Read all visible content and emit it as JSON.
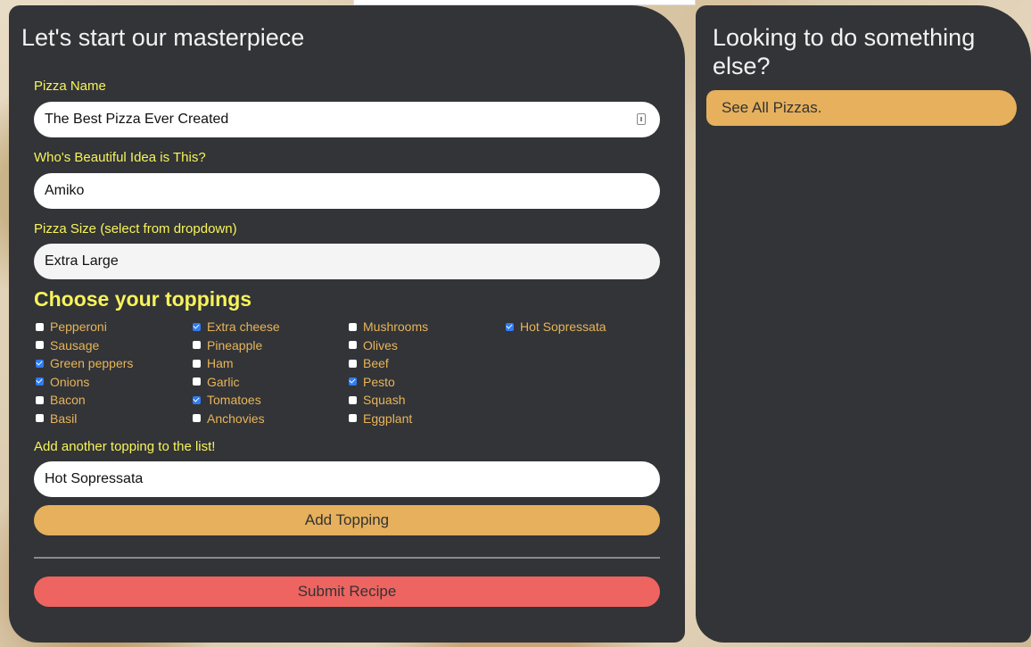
{
  "main": {
    "title": "Let's start our masterpiece",
    "pizza_name": {
      "label": "Pizza Name",
      "value": "The Best Pizza Ever Created"
    },
    "creator": {
      "label": "Who's Beautiful Idea is This?",
      "value": "Amiko"
    },
    "size": {
      "label": "Pizza Size (select from dropdown)",
      "value": "Extra Large"
    },
    "toppings_title": "Choose your toppings",
    "toppings": [
      {
        "label": "Pepperoni",
        "checked": false
      },
      {
        "label": "Sausage",
        "checked": false
      },
      {
        "label": "Green peppers",
        "checked": true
      },
      {
        "label": "Onions",
        "checked": true
      },
      {
        "label": "Bacon",
        "checked": false
      },
      {
        "label": "Basil",
        "checked": false
      },
      {
        "label": "Extra cheese",
        "checked": true
      },
      {
        "label": "Pineapple",
        "checked": false
      },
      {
        "label": "Ham",
        "checked": false
      },
      {
        "label": "Garlic",
        "checked": false
      },
      {
        "label": "Tomatoes",
        "checked": true
      },
      {
        "label": "Anchovies",
        "checked": false
      },
      {
        "label": "Mushrooms",
        "checked": false
      },
      {
        "label": "Olives",
        "checked": false
      },
      {
        "label": "Beef",
        "checked": false
      },
      {
        "label": "Pesto",
        "checked": true
      },
      {
        "label": "Squash",
        "checked": false
      },
      {
        "label": "Eggplant",
        "checked": false
      },
      {
        "label": "Hot Sopressata",
        "checked": true
      }
    ],
    "new_topping": {
      "label": "Add another topping to the list!",
      "value": "Hot Sopressata"
    },
    "add_topping_button": "Add Topping",
    "submit_button": "Submit Recipe"
  },
  "side": {
    "title": "Looking to do something else?",
    "see_all_link": "See All Pizzas."
  },
  "colors": {
    "panel": "#323437",
    "label_yellow": "#f7f35a",
    "topping_orange": "#e8b45a",
    "button_orange": "#e6b05c",
    "submit_red": "#ee6461",
    "checkbox_blue": "#2f7cf6"
  }
}
